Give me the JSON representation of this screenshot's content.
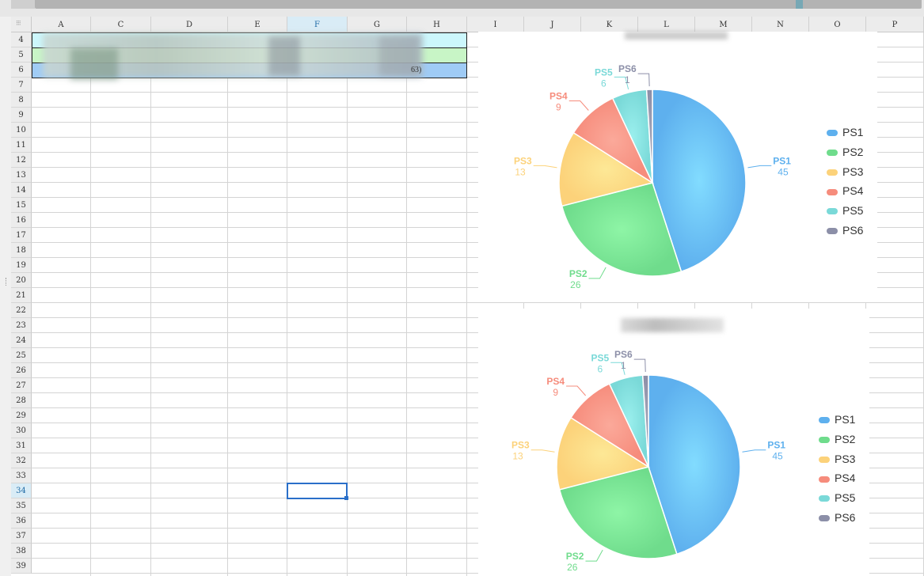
{
  "columns": [
    "A",
    "C",
    "D",
    "E",
    "F",
    "G",
    "H",
    "I",
    "J",
    "K",
    "L",
    "M",
    "N",
    "O",
    "P"
  ],
  "active_column": "F",
  "rows": [
    4,
    5,
    6,
    7,
    8,
    9,
    10,
    11,
    12,
    13,
    14,
    15,
    16,
    17,
    18,
    19,
    20,
    21,
    22,
    23,
    24,
    25,
    26,
    27,
    28,
    29,
    30,
    31,
    32,
    33,
    34,
    35,
    36,
    37,
    38,
    39
  ],
  "active_row": 34,
  "data_rows": [
    {
      "row": 4,
      "fill": "#ccf7fc"
    },
    {
      "row": 5,
      "fill": "#c8f5c6"
    },
    {
      "row": 6,
      "fill": "#9fcbf5"
    }
  ],
  "row6_fragment": "63)",
  "charts": [
    {
      "title": "",
      "chart_data": {
        "type": "pie",
        "categories": [
          "PS1",
          "PS2",
          "PS3",
          "PS4",
          "PS5",
          "PS6"
        ],
        "values": [
          45,
          26,
          13,
          9,
          6,
          1
        ],
        "colors": [
          "#5eb0ee",
          "#6fdc8c",
          "#fcd27a",
          "#f68c7c",
          "#7ad9d8",
          "#8c8fa8"
        ],
        "legend": "right"
      }
    },
    {
      "title": "",
      "chart_data": {
        "type": "pie",
        "categories": [
          "PS1",
          "PS2",
          "PS3",
          "PS4",
          "PS5",
          "PS6"
        ],
        "values": [
          45,
          26,
          13,
          9,
          6,
          1
        ],
        "colors": [
          "#5eb0ee",
          "#6fdc8c",
          "#fcd27a",
          "#f68c7c",
          "#7ad9d8",
          "#8c8fa8"
        ],
        "legend": "right"
      }
    }
  ]
}
